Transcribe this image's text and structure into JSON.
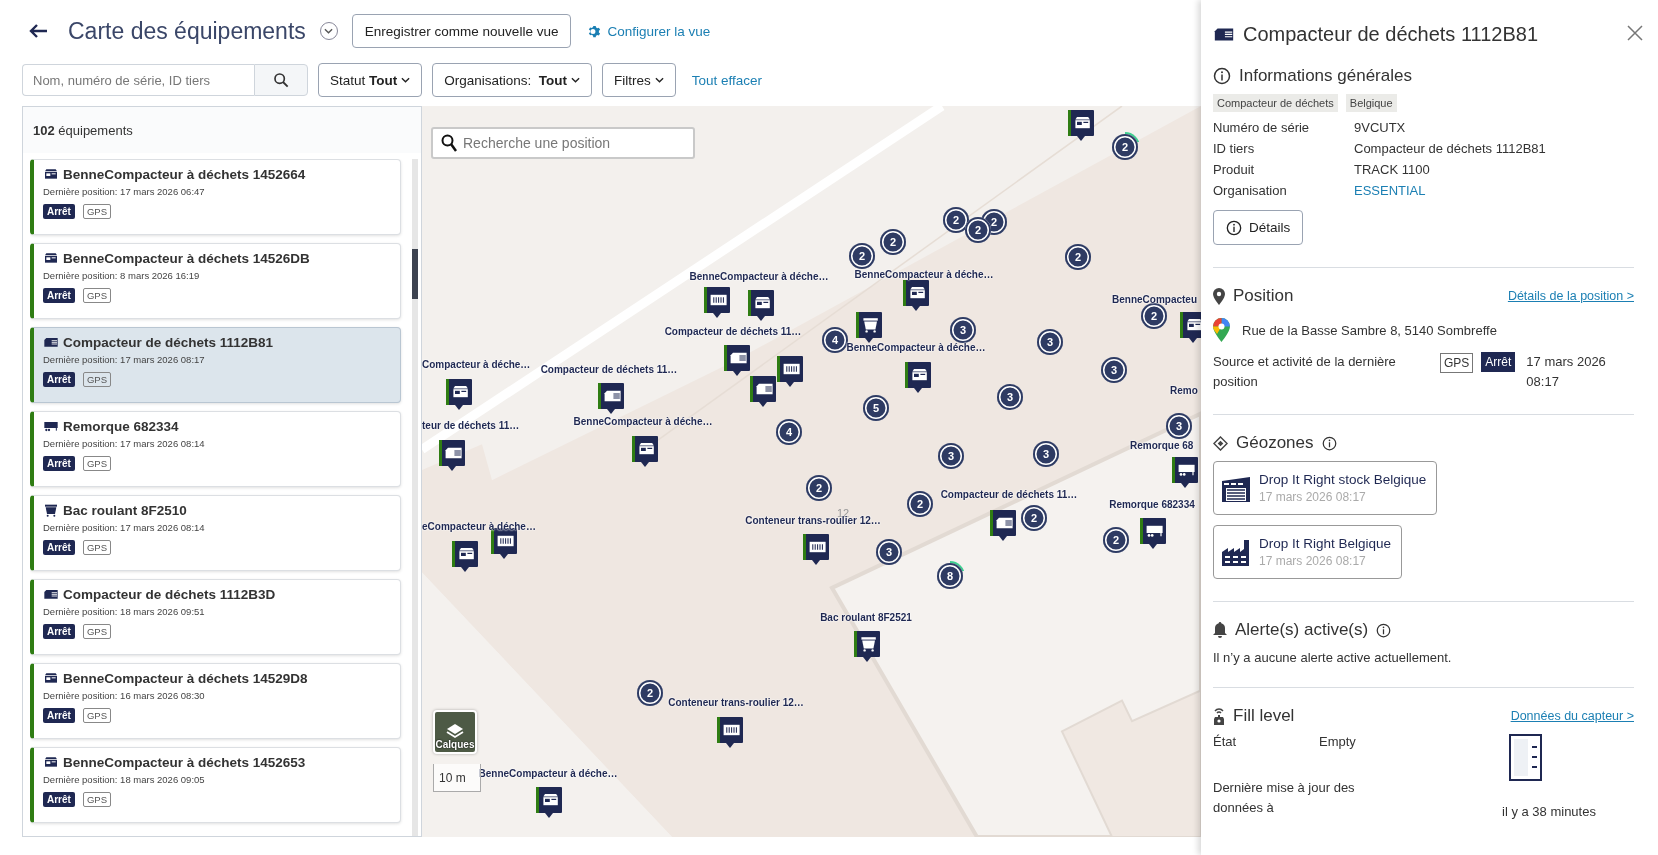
{
  "header": {
    "title": "Carte des équipements",
    "save_view": "Enregistrer comme nouvelle vue",
    "configure": "Configurer la vue"
  },
  "filters": {
    "search_placeholder": "Nom, numéro de série, ID tiers",
    "chips": [
      {
        "label": "Statut **Tout**"
      },
      {
        "label": "Organisations:  **Tout**"
      },
      {
        "label": "Filtres"
      }
    ],
    "clear": "Tout effacer"
  },
  "list": {
    "count": "**102** équipements",
    "items": [
      {
        "kind": "benne",
        "name": "BenneCompacteur à déchets 1452664",
        "last_position": "Dernière position: 17 mars 2026 06:47",
        "status": "Arrêt",
        "source": "GPS",
        "selected": false
      },
      {
        "kind": "benne",
        "name": "BenneCompacteur à déchets 14526DB",
        "last_position": "Dernière position: 8 mars 2026 16:19",
        "status": "Arrêt",
        "source": "GPS",
        "selected": false
      },
      {
        "kind": "compacteur",
        "name": "Compacteur de déchets 1112B81",
        "last_position": "Dernière position: 17 mars 2026 08:17",
        "status": "Arrêt",
        "source": "GPS",
        "selected": true
      },
      {
        "kind": "trailer",
        "name": "Remorque 682334",
        "last_position": "Dernière position: 17 mars 2026 08:14",
        "status": "Arrêt",
        "source": "GPS",
        "selected": false
      },
      {
        "kind": "bin",
        "name": "Bac roulant 8F2510",
        "last_position": "Dernière position: 17 mars 2026 08:14",
        "status": "Arrêt",
        "source": "GPS",
        "selected": false
      },
      {
        "kind": "compacteur",
        "name": "Compacteur de déchets 1112B3D",
        "last_position": "Dernière position: 18 mars 2026 09:51",
        "status": "Arrêt",
        "source": "GPS",
        "selected": false
      },
      {
        "kind": "benne",
        "name": "BenneCompacteur à déchets 14529D8",
        "last_position": "Dernière position: 16 mars 2026 08:30",
        "status": "Arrêt",
        "source": "GPS",
        "selected": false
      },
      {
        "kind": "benne",
        "name": "BenneCompacteur à déchets 1452653",
        "last_position": "Dernière position: 18 mars 2026 09:05",
        "status": "Arrêt",
        "source": "GPS",
        "selected": false
      }
    ]
  },
  "map": {
    "search_placeholder": "Recherche une position",
    "layers": "Calques",
    "scale": "10 m",
    "street_number": "12",
    "clusters": [
      {
        "count": "2",
        "kind": "highlighted"
      },
      {
        "count": "2",
        "kind": "plain"
      },
      {
        "count": "2",
        "kind": "plain"
      },
      {
        "count": "2",
        "kind": "plain"
      },
      {
        "count": "2",
        "kind": "plain"
      },
      {
        "count": "2",
        "kind": "plain"
      },
      {
        "count": "2",
        "kind": "plain"
      },
      {
        "count": "2",
        "kind": "plain"
      },
      {
        "count": "4",
        "kind": "plain"
      },
      {
        "count": "3",
        "kind": "plain"
      },
      {
        "count": "3",
        "kind": "plain"
      },
      {
        "count": "3",
        "kind": "plain"
      },
      {
        "count": "5",
        "kind": "plain"
      },
      {
        "count": "3",
        "kind": "plain"
      },
      {
        "count": "3",
        "kind": "plain"
      },
      {
        "count": "4",
        "kind": "plain"
      },
      {
        "count": "3",
        "kind": "plain"
      },
      {
        "count": "3",
        "kind": "plain"
      },
      {
        "count": "2",
        "kind": "plain"
      },
      {
        "count": "2",
        "kind": "plain"
      },
      {
        "count": "2",
        "kind": "plain"
      },
      {
        "count": "2",
        "kind": "plain"
      },
      {
        "count": "3",
        "kind": "plain"
      },
      {
        "count": "8",
        "kind": "highlighted"
      },
      {
        "count": "2",
        "kind": "plain"
      }
    ],
    "markers": [
      {
        "kind": "benne"
      },
      {
        "kind": "container"
      },
      {
        "kind": "benne"
      },
      {
        "kind": "bin"
      },
      {
        "kind": "benne"
      },
      {
        "kind": "benne"
      },
      {
        "kind": "benne"
      },
      {
        "kind": "compacteur"
      },
      {
        "kind": "compacteur"
      },
      {
        "kind": "container"
      },
      {
        "kind": "compacteur"
      },
      {
        "kind": "benne"
      },
      {
        "kind": "compacteur"
      },
      {
        "kind": "benne"
      },
      {
        "kind": "trailer"
      },
      {
        "kind": "container"
      },
      {
        "kind": "benne"
      },
      {
        "kind": "container"
      },
      {
        "kind": "compacteur"
      },
      {
        "kind": "trailer"
      },
      {
        "kind": "bin"
      },
      {
        "kind": "container"
      },
      {
        "kind": "benne"
      }
    ],
    "labels": [
      "BenneCompacteur à déche…",
      "BenneCompacteur à déche…",
      "BenneCompacteu",
      "Compacteur de déchets 11…",
      "BenneCompacteur à déche…",
      "Compacteur à déche…",
      "Compacteur de déchets 11…",
      "teur de déchets 11…",
      "BenneCompacteur à déche…",
      "Remo",
      "Remorque 68",
      "eCompacteur à déche…",
      "Conteneur trans-roulier 12…",
      "Compacteur de déchets 11…",
      "Remorque 682334",
      "Bac roulant 8F2521",
      "Conteneur trans-roulier 12…",
      "BenneCompacteur à déche…"
    ]
  },
  "detail": {
    "kind": "compacteur",
    "title": "Compacteur de déchets 1112B81",
    "general": {
      "heading": "Informations générales",
      "tags": [
        "Compacteur de déchets",
        "Belgique"
      ],
      "fields": [
        {
          "label": "Numéro de série",
          "value": "9VCUTX",
          "kind": "text"
        },
        {
          "label": "ID tiers",
          "value": "Compacteur de déchets 1112B81",
          "kind": "text"
        },
        {
          "label": "Produit",
          "value": "TRACK 1100",
          "kind": "text"
        },
        {
          "label": "Organisation",
          "value": "ESSENTIAL",
          "kind": "link"
        }
      ],
      "details_button": "Détails"
    },
    "position": {
      "heading": "Position",
      "link": "Détails de la position >",
      "address": "Rue de la Basse Sambre 8, 5140 Sombreffe",
      "source_label": "Source et activité de la dernière position",
      "source": "GPS",
      "status": "Arrêt",
      "date": "17 mars 2026 08:17"
    },
    "geozones": {
      "heading": "Géozones",
      "items": [
        {
          "kind": "warehouse",
          "name": "Drop It Right stock Belgique",
          "date": "17 mars 2026 08:17"
        },
        {
          "kind": "factory",
          "name": "Drop It Right Belgique",
          "date": "17 mars 2026 08:17"
        }
      ]
    },
    "alerts": {
      "heading": "Alerte(s) active(s)",
      "message": "Il n’y a aucune alerte active actuellement."
    },
    "fill": {
      "heading": "Fill level",
      "link": "Données du capteur >",
      "state_label": "État",
      "state": "Empty",
      "level": 0,
      "updated_label": "Dernière mise à jour des données à",
      "updated": "il y a 38 minutes"
    }
  }
}
